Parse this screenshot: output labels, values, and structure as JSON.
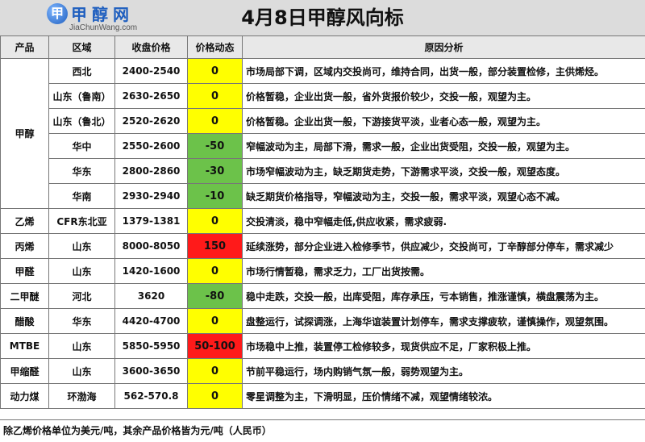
{
  "header": {
    "title": "4月8日甲醇风向标",
    "logo_cn": "甲醇网",
    "logo_en": "JiaChunWang.com"
  },
  "columns": [
    "产品",
    "区域",
    "收盘价格",
    "价格动态",
    "原因分析"
  ],
  "rows": [
    {
      "product": "甲醇",
      "region": "西北",
      "price": "2400-2540",
      "change": "0",
      "reason": "市场局部下调，区域内交投尚可，维持合同，出货一般，部分装置检修，主供烯烃。"
    },
    {
      "product": "",
      "region": "山东（鲁南）",
      "price": "2630-2650",
      "change": "0",
      "reason": "价格暂稳，企业出货一般，省外货报价较少，交投一般，观望为主。"
    },
    {
      "product": "",
      "region": "山东（鲁北）",
      "price": "2520-2620",
      "change": "0",
      "reason": "价格暂稳。企业出货一般，下游接货平淡，业者心态一般，观望为主。"
    },
    {
      "product": "",
      "region": "华中",
      "price": "2550-2600",
      "change": "-50",
      "reason": "窄幅波动为主，局部下滑，需求一般，企业出货受阻，交投一般，观望为主。"
    },
    {
      "product": "",
      "region": "华东",
      "price": "2800-2860",
      "change": "-30",
      "reason": "市场窄幅波动为主，缺乏期货走势，下游需求平淡，交投一般，观望态度。"
    },
    {
      "product": "",
      "region": "华南",
      "price": "2930-2940",
      "change": "-10",
      "reason": "缺乏期货价格指导，窄幅波动为主，交投一般，需求平淡，观望心态不减。"
    },
    {
      "product": "乙烯",
      "region": "CFR东北亚",
      "price": "1379-1381",
      "change": "0",
      "reason": "交投清淡，稳中窄幅走低,供应收紧，需求疲弱."
    },
    {
      "product": "丙烯",
      "region": "山东",
      "price": "8000-8050",
      "change": "150",
      "reason": "延续涨势，部分企业进入检修季节，供应减少，交投尚可，丁辛醇部分停车，需求减少"
    },
    {
      "product": "甲醛",
      "region": "山东",
      "price": "1420-1600",
      "change": "0",
      "reason": "市场行情暂稳，需求乏力，工厂出货按需。"
    },
    {
      "product": "二甲醚",
      "region": "河北",
      "price": "3620",
      "change": "-80",
      "reason": "稳中走跌，交投一般，出库受阻，库存承压，亏本销售，推涨谨慎，横盘震荡为主。"
    },
    {
      "product": "醋酸",
      "region": "华东",
      "price": "4420-4700",
      "change": "0",
      "reason": "盘整运行，试探调涨，上海华谊装置计划停车，需求支撑疲软，谨慎操作，观望氛围。"
    },
    {
      "product": "MTBE",
      "region": "山东",
      "price": "5850-5950",
      "change": "50-100",
      "reason": "市场稳中上推，装置停工检修较多，现货供应不足，厂家积极上推。"
    },
    {
      "product": "甲缩醛",
      "region": "山东",
      "price": "3600-3650",
      "change": "0",
      "reason": "节前平稳运行，场内购销气氛一般，弱势观望为主。"
    },
    {
      "product": "动力煤",
      "region": "环渤海",
      "price": "562-570.8",
      "change": "0",
      "reason": "零星调整为主，下滑明显，压价情绪不减，观望情绪较浓。"
    }
  ],
  "footer": {
    "note": "除乙烯价格单位为美元/吨，其余产品价格皆为元/吨（人民币）"
  },
  "colors": {
    "unchanged": "#ffff00",
    "down": "#6cc24a",
    "up": "#ff1a1a"
  }
}
